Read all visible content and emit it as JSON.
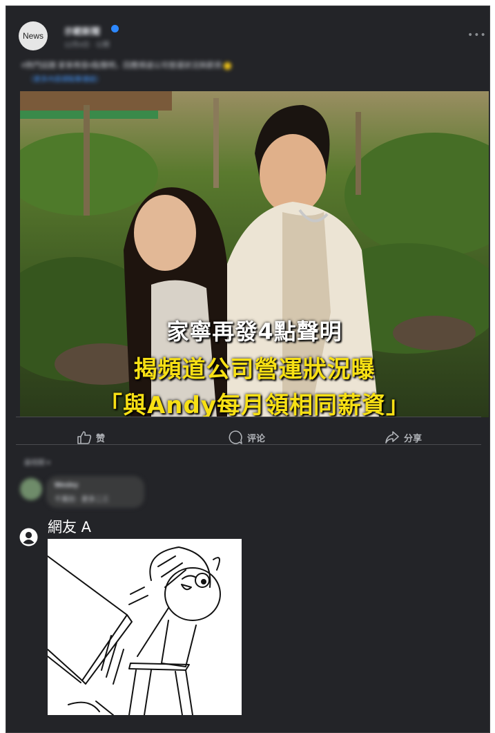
{
  "post": {
    "avatar_text": "News",
    "page_name": "示範新聞",
    "time": "12月4日 · 公開",
    "text": "#熱門話題 家寧再發4點聲明，回應頻道公司營運狀況與薪資",
    "link": "（更多內容請點擊連結）"
  },
  "image_overlay": {
    "line1": "家寧再發4點聲明",
    "line2": "揭頻道公司營運狀況曝",
    "line3": "「與Andy每月領相同薪資」"
  },
  "actions": {
    "like": "赞",
    "comment": "评论",
    "share": "分享"
  },
  "comments": {
    "sort_label": "最相關 ▾",
    "first": {
      "name": "Wesley",
      "text": "千萬別 · 更多二三"
    },
    "netizen_name": "網友 A"
  },
  "colors": {
    "card_bg": "#232428",
    "overlay_yellow": "#f7e014",
    "link_blue": "#4599ff"
  }
}
